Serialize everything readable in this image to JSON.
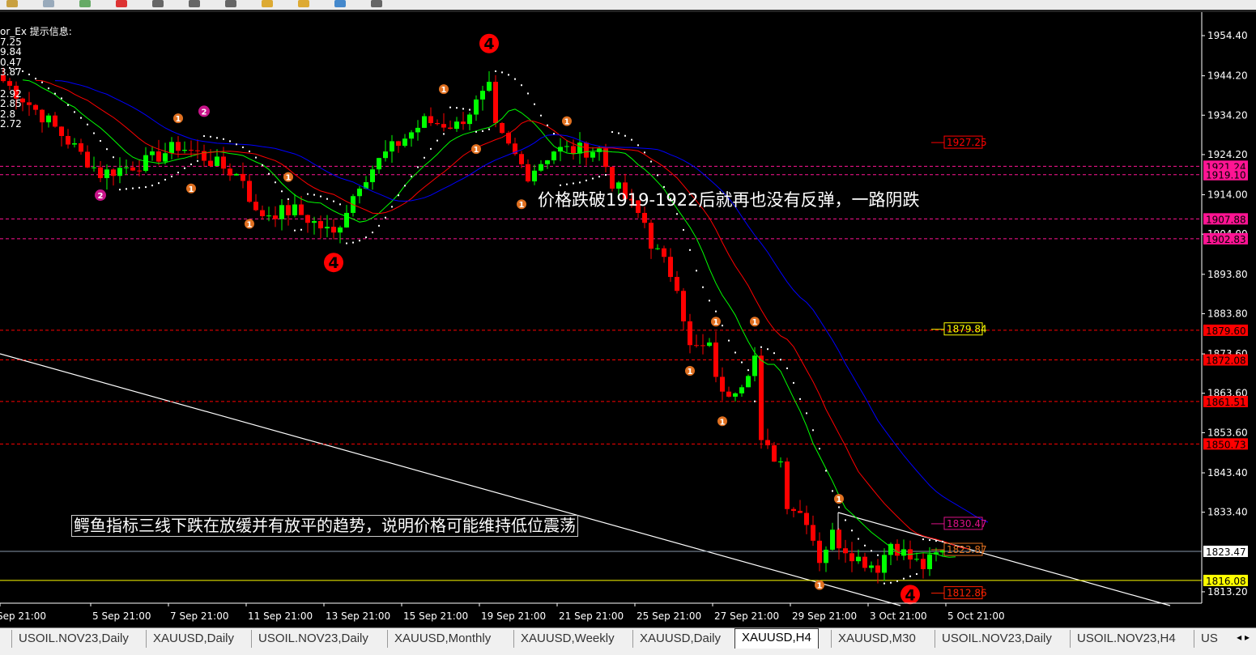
{
  "toolbar": {
    "icons": [
      "open-icon",
      "save-icon",
      "profiles-icon",
      "autotrading-icon",
      "crosshair-icon",
      "zoom-in-icon",
      "zoom-out-icon",
      "tile-icon",
      "new-order-icon",
      "history-icon",
      "chart-icon"
    ]
  },
  "info_panel": {
    "title": "or_Ex 提示信息:",
    "values": [
      "7.25",
      "9.84",
      "0.47",
      "3.87",
      "2.92",
      "2.85",
      "2.8",
      "2.72"
    ]
  },
  "annotations": {
    "note1": "价格跌破1919-1922后就再也没有反弹，一路阴跌",
    "note2": "鳄鱼指标三线下跌在放缓并有放平的趋势，说明价格可能维持低位震荡"
  },
  "colors": {
    "bull": "#00ff00",
    "bear": "#ff0000",
    "lips": "#00ff00",
    "teeth": "#ff0000",
    "jaw": "#0000ff",
    "sar": "#ffffff",
    "pink": "#ff1493",
    "red": "#ff0000",
    "yellow": "#ffff00"
  },
  "chart_data": {
    "type": "candlestick",
    "symbol": "XAUUSD",
    "timeframe": "H4",
    "ylim": [
      1810.5,
      1958.5
    ],
    "price_ticks": [
      "1954.40",
      "1944.20",
      "1934.20",
      "1924.20",
      "1914.00",
      "1904.00",
      "1893.80",
      "1883.80",
      "1873.60",
      "1863.60",
      "1853.60",
      "1843.40",
      "1833.40",
      "1813.20"
    ],
    "time_ticks": [
      {
        "label": "Sep 21:00",
        "bar": 0
      },
      {
        "label": "5 Sep 21:00",
        "bar": 14
      },
      {
        "label": "7 Sep 21:00",
        "bar": 26
      },
      {
        "label": "11 Sep 21:00",
        "bar": 38
      },
      {
        "label": "13 Sep 21:00",
        "bar": 50
      },
      {
        "label": "15 Sep 21:00",
        "bar": 62
      },
      {
        "label": "19 Sep 21:00",
        "bar": 74
      },
      {
        "label": "21 Sep 21:00",
        "bar": 86
      },
      {
        "label": "25 Sep 21:00",
        "bar": 98
      },
      {
        "label": "27 Sep 21:00",
        "bar": 110
      },
      {
        "label": "29 Sep 21:00",
        "bar": 122
      },
      {
        "label": "3 Oct 21:00",
        "bar": 134
      },
      {
        "label": "5 Oct 21:00",
        "bar": 146
      }
    ],
    "close_keyframes": [
      [
        0,
        1942.9
      ],
      [
        7,
        1932.6
      ],
      [
        15,
        1919.3
      ],
      [
        22,
        1922.3
      ],
      [
        27,
        1926.4
      ],
      [
        30,
        1924.4
      ],
      [
        37,
        1918.2
      ],
      [
        39,
        1909
      ],
      [
        45,
        1910
      ],
      [
        51,
        1903.8
      ],
      [
        55,
        1917.2
      ],
      [
        59,
        1924.4
      ],
      [
        65,
        1932.6
      ],
      [
        70,
        1931.6
      ],
      [
        75,
        1940.8
      ],
      [
        76,
        1930.5
      ],
      [
        81,
        1919.3
      ],
      [
        85,
        1925.4
      ],
      [
        92,
        1925.4
      ],
      [
        94,
        1917.2
      ],
      [
        99,
        1907
      ],
      [
        100,
        1901.8
      ],
      [
        104,
        1891.5
      ],
      [
        106,
        1875
      ],
      [
        109,
        1875
      ],
      [
        111,
        1862.7
      ],
      [
        114,
        1866.8
      ],
      [
        116,
        1873
      ],
      [
        117,
        1850.4
      ],
      [
        120,
        1846.3
      ],
      [
        121,
        1836
      ],
      [
        124,
        1831.9
      ],
      [
        126,
        1821.6
      ],
      [
        128,
        1827.8
      ],
      [
        129,
        1825.7
      ],
      [
        132,
        1821.6
      ],
      [
        135,
        1819.6
      ],
      [
        137,
        1825.7
      ],
      [
        140,
        1821.6
      ],
      [
        142,
        1819.6
      ],
      [
        145,
        1823.7
      ]
    ],
    "current_price": "1823.47",
    "horizontal_levels": [
      {
        "price": 1921.24,
        "label": "1921.24",
        "color": "#ff1493",
        "style": "dashed"
      },
      {
        "price": 1919.1,
        "label": "1919.10",
        "color": "#ff1493",
        "style": "dashed"
      },
      {
        "price": 1907.88,
        "label": "1907.88",
        "color": "#ff1493",
        "style": "dashed"
      },
      {
        "price": 1902.83,
        "label": "1902.83",
        "color": "#ff1493",
        "style": "dashed"
      },
      {
        "price": 1879.6,
        "label": "1879.60",
        "color": "#ff0000",
        "style": "dashed"
      },
      {
        "price": 1872.08,
        "label": "1872.08",
        "color": "#ff0000",
        "style": "dashed"
      },
      {
        "price": 1861.51,
        "label": "1861.51",
        "color": "#ff0000",
        "style": "dashed"
      },
      {
        "price": 1850.73,
        "label": "1850.73",
        "color": "#ff0000",
        "style": "dashed"
      },
      {
        "price": 1816.08,
        "label": "1816.08",
        "color": "#ffff00",
        "style": "solid"
      },
      {
        "price": 1823.47,
        "label": "1823.47",
        "color": "#8899aa",
        "style": "solid"
      }
    ],
    "price_tags": [
      {
        "label": "1927.25",
        "price": 1927.25,
        "color": "#ff0000"
      },
      {
        "label": "1879.84",
        "price": 1879.84,
        "color": "#ffff00"
      },
      {
        "label": "1830.47",
        "price": 1830.47,
        "color": "#dd1188"
      },
      {
        "label": "1823.87",
        "price": 1823.87,
        "color": "#e07020"
      },
      {
        "label": "1812.86",
        "price": 1812.86,
        "color": "#ff2200"
      }
    ],
    "wave_markers": [
      {
        "label": "4",
        "bar": 75,
        "price": 1952.4,
        "type": "big"
      },
      {
        "label": "4",
        "bar": 51,
        "price": 1896.8,
        "type": "big"
      },
      {
        "label": "4",
        "bar": 140,
        "price": 1812.5,
        "type": "big"
      },
      {
        "label": "2",
        "bar": 31,
        "price": 1935.2,
        "type": "mag"
      },
      {
        "label": "2",
        "bar": 15,
        "price": 1913.9,
        "type": "mag"
      },
      {
        "label": "1",
        "bar": 27,
        "price": 1933.4,
        "type": "or"
      },
      {
        "label": "1",
        "bar": 29,
        "price": 1915.6,
        "type": "or"
      },
      {
        "label": "1",
        "bar": 44,
        "price": 1918.5,
        "type": "or"
      },
      {
        "label": "1",
        "bar": 38,
        "price": 1906.6,
        "type": "or"
      },
      {
        "label": "1",
        "bar": 68,
        "price": 1940.8,
        "type": "or"
      },
      {
        "label": "1",
        "bar": 73,
        "price": 1925.6,
        "type": "or"
      },
      {
        "label": "1",
        "bar": 87,
        "price": 1932.7,
        "type": "or"
      },
      {
        "label": "1",
        "bar": 80,
        "price": 1911.6,
        "type": "or"
      },
      {
        "label": "1",
        "bar": 110,
        "price": 1881.8,
        "type": "or"
      },
      {
        "label": "1",
        "bar": 116,
        "price": 1881.8,
        "type": "or"
      },
      {
        "label": "1",
        "bar": 106,
        "price": 1869.3,
        "type": "or"
      },
      {
        "label": "1",
        "bar": 111,
        "price": 1856.5,
        "type": "or"
      },
      {
        "label": "1",
        "bar": 129,
        "price": 1951.0,
        "type": "none"
      },
      {
        "label": "1",
        "bar": 129,
        "price": 1836.8,
        "type": "or"
      },
      {
        "label": "1",
        "bar": 126,
        "price": 1814.9,
        "type": "or"
      }
    ]
  },
  "tabs": [
    {
      "label": "USOIL.NOV23,Daily",
      "active": false
    },
    {
      "label": "XAUUSD,Daily",
      "active": false
    },
    {
      "label": "USOIL.NOV23,Daily",
      "active": false
    },
    {
      "label": "XAUUSD,Monthly",
      "active": false
    },
    {
      "label": "XAUUSD,Weekly",
      "active": false
    },
    {
      "label": "XAUUSD,Daily",
      "active": false
    },
    {
      "label": "XAUUSD,H4",
      "active": true
    },
    {
      "label": "XAUUSD,M30",
      "active": false
    },
    {
      "label": "USOIL.NOV23,Daily",
      "active": false
    },
    {
      "label": "USOIL.NOV23,H4",
      "active": false
    },
    {
      "label": "US",
      "active": false
    }
  ],
  "tab_scroll": "◂ ▸"
}
